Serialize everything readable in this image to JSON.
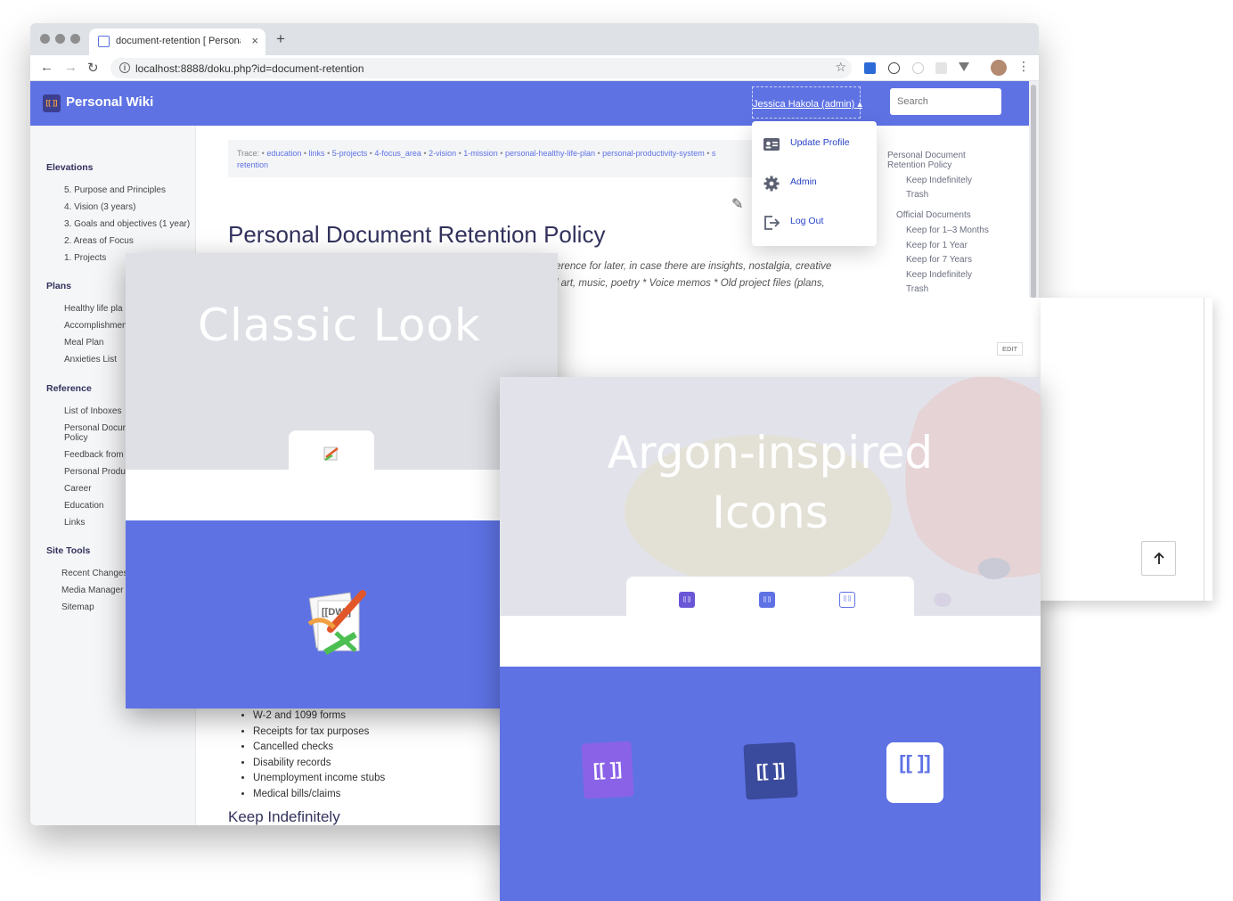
{
  "browser": {
    "tab_title": "document-retention [ Personal",
    "tab_close": "×",
    "new_tab": "+",
    "url": "localhost:8888/doku.php?id=document-retention",
    "back": "←",
    "forward": "→",
    "reload": "↻",
    "info": "i",
    "star": "☆",
    "menu": "⋮"
  },
  "wiki": {
    "site_title": "Personal Wiki",
    "logo_text": "[[ ]]",
    "user_menu_label": "Jessica Hakola (admin) ▴",
    "search_placeholder": "Search",
    "trace_prefix": "Trace: •",
    "trace_links": [
      "education",
      "links",
      "5-projects",
      "4-focus_area",
      "2-vision",
      "1-mission",
      "personal-healthy-life-plan",
      "personal-productivity-system",
      "s"
    ],
    "trace_tail": "retention",
    "page_title": "Personal Document Retention Policy",
    "intro_line1": "ference for later, in case there are insights, nostalgia, creative",
    "intro_line2": "d art, music, poetry * Voice memos * Old project files (plans,",
    "edit_label": "EDIT",
    "doc_list": [
      "W-2 and 1099 forms",
      "Receipts for tax purposes",
      "Cancelled checks",
      "Disability records",
      "Unemployment income stubs",
      "Medical bills/claims"
    ],
    "keep_heading": "Keep Indefinitely",
    "pencil": "✎"
  },
  "sidebar": {
    "sections": [
      {
        "title": "Elevations",
        "items": [
          "5. Purpose and Principles",
          "4. Vision (3 years)",
          "3. Goals and objectives (1 year)",
          "2. Areas of Focus",
          "1. Projects"
        ]
      },
      {
        "title": "Plans",
        "items": [
          "Healthy life pla",
          "Accomplishmen",
          "Meal Plan",
          "Anxieties List"
        ]
      },
      {
        "title": "Reference",
        "items": [
          "List of Inboxes",
          "Personal Docur",
          "Policy",
          "Feedback from",
          "Personal Produ",
          "Career",
          "Education",
          "Links"
        ]
      },
      {
        "title": "Site Tools",
        "items": [
          "Recent Changes",
          "Media Manager",
          "Sitemap"
        ]
      }
    ]
  },
  "toc": {
    "items": [
      "Personal Document",
      "Retention Policy",
      "Keep Indefinitely",
      "Trash",
      "Official Documents",
      "Keep for 1–3 Months",
      "Keep for 1 Year",
      "Keep for 7 Years",
      "Keep Indefinitely",
      "Trash"
    ]
  },
  "dropdown": {
    "items": [
      "Update Profile",
      "Admin",
      "Log Out"
    ]
  },
  "cards": {
    "classic_title": "Classic Look",
    "argon_title_line1": "Argon-inspired",
    "argon_title_line2": "Icons",
    "logo_text": "[[DW]]",
    "bracket": "[[ ]]"
  },
  "colors": {
    "accent": "#5e72e4",
    "header_dark": "#32325d",
    "card_gray": "#dee0e5"
  }
}
